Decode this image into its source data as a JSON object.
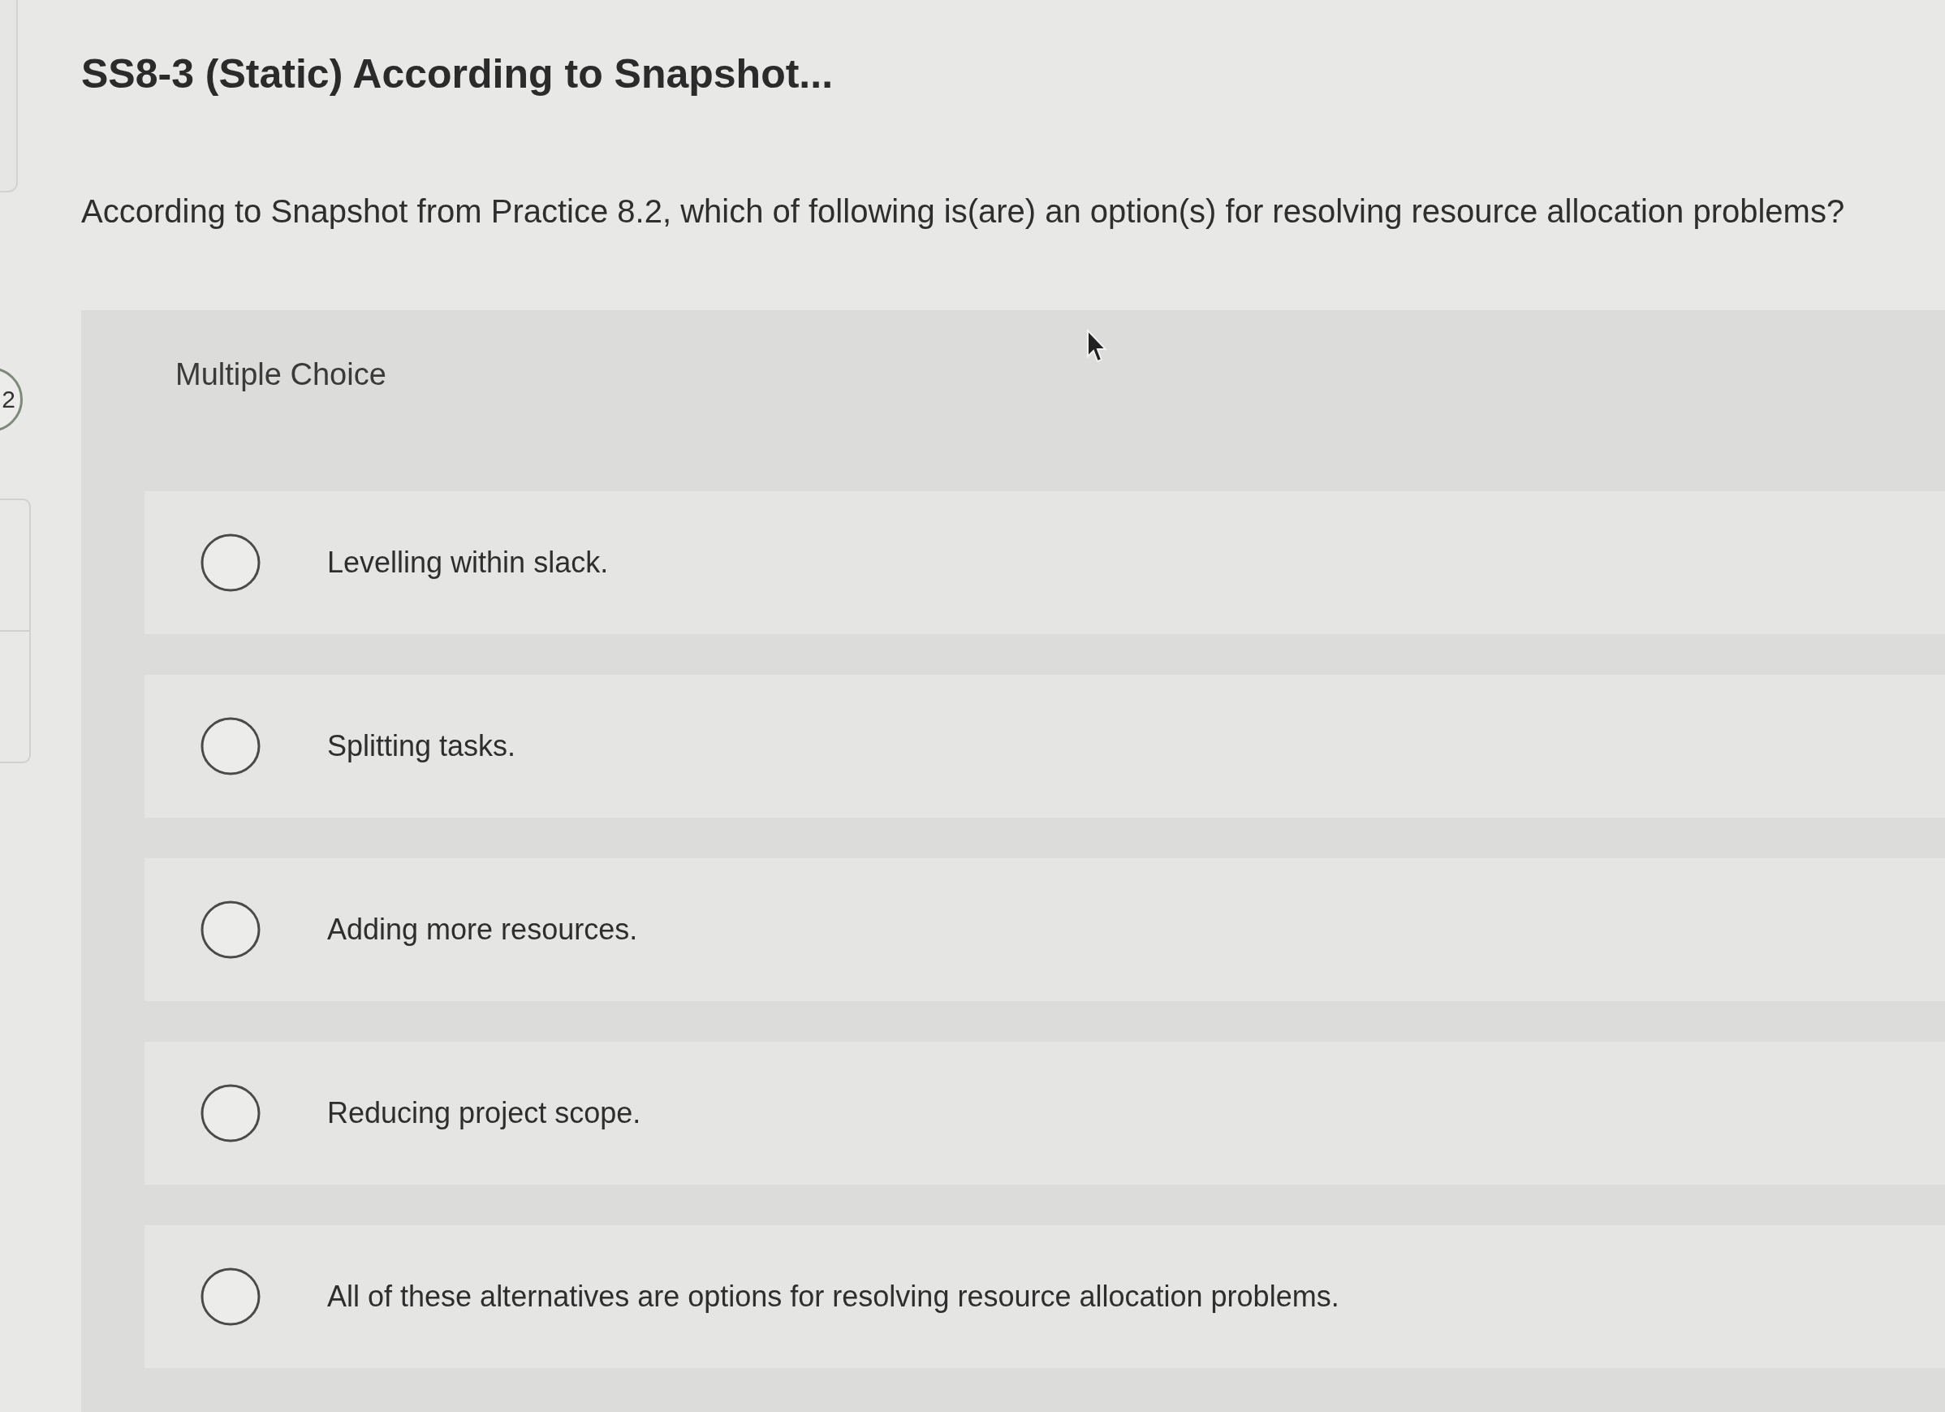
{
  "nav": {
    "question_number": "2"
  },
  "question": {
    "title": "SS8-3 (Static) According to Snapshot...",
    "prompt": "According to Snapshot from Practice 8.2, which of following is(are) an option(s) for resolving resource allocation problems?"
  },
  "answer_panel": {
    "type_label": "Multiple Choice",
    "options": [
      {
        "label": "Levelling within slack.",
        "selected": false
      },
      {
        "label": "Splitting tasks.",
        "selected": false
      },
      {
        "label": "Adding more resources.",
        "selected": false
      },
      {
        "label": "Reducing project scope.",
        "selected": false
      },
      {
        "label": "All of these alternatives are options for resolving resource allocation problems.",
        "selected": false
      }
    ]
  }
}
